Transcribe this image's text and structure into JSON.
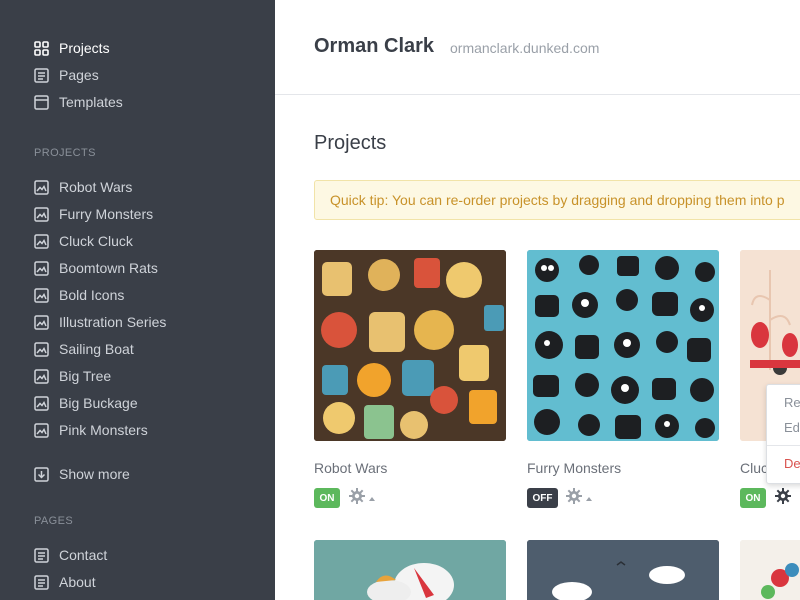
{
  "sidebar": {
    "nav": [
      {
        "label": "Projects",
        "icon": "grid-icon"
      },
      {
        "label": "Pages",
        "icon": "page-icon"
      },
      {
        "label": "Templates",
        "icon": "template-icon"
      }
    ],
    "projects_heading": "PROJECTS",
    "projects": [
      "Robot Wars",
      "Furry Monsters",
      "Cluck Cluck",
      "Boomtown Rats",
      "Bold Icons",
      "Illustration Series",
      "Sailing Boat",
      "Big Tree",
      "Big Buckage",
      "Pink Monsters"
    ],
    "show_more": "Show more",
    "pages_heading": "PAGES",
    "pages": [
      "Contact",
      "About"
    ]
  },
  "header": {
    "name": "Orman Clark",
    "url": "ormanclark.dunked.com"
  },
  "main": {
    "title": "Projects",
    "tip": "Quick tip: You can re-order projects by dragging and dropping them into p",
    "cards": [
      {
        "name": "Robot Wars",
        "status": "ON"
      },
      {
        "name": "Furry Monsters",
        "status": "OFF"
      },
      {
        "name": "Cluc",
        "status": "ON"
      }
    ],
    "menu": {
      "item1": "Re",
      "item2": "Ed",
      "danger": "De"
    }
  },
  "colors": {
    "sidebar_bg": "#3a3f48",
    "on": "#5cb85c",
    "off": "#3a3f48",
    "tip_text": "#c8922a",
    "danger": "#d9534f"
  }
}
